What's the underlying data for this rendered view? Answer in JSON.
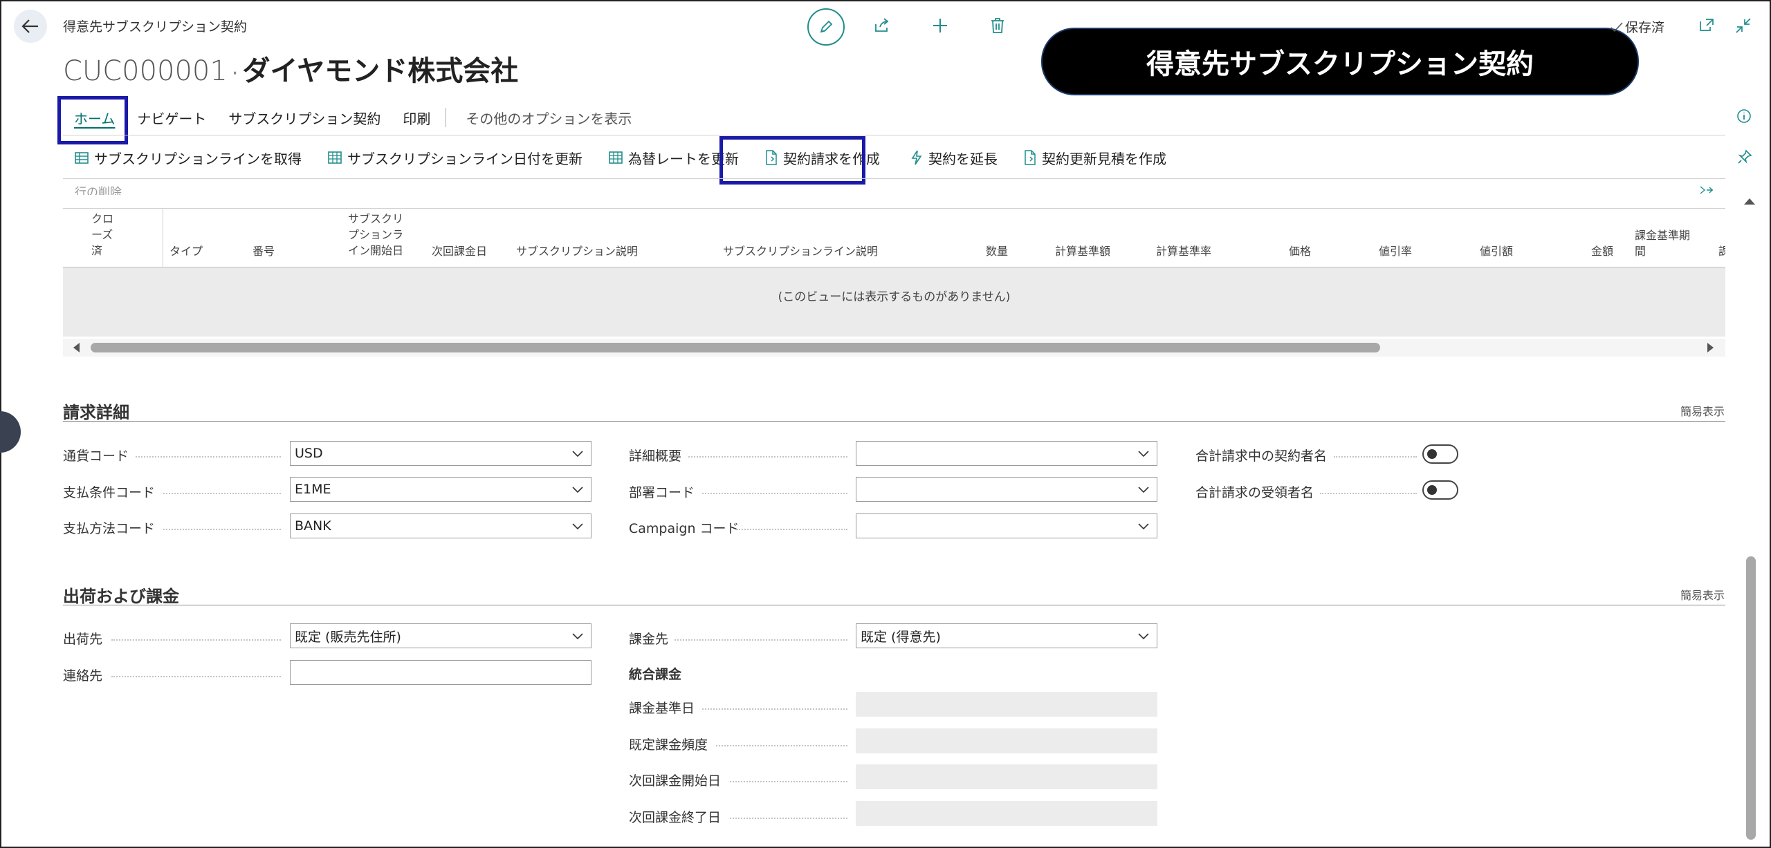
{
  "page": {
    "breadcrumb": "得意先サブスクリプション契約",
    "record_code": "CUC000001",
    "record_sep": "·",
    "record_name": "ダイヤモンド株式会社",
    "banner": "得意先サブスクリプション契約",
    "saved_status": "保存済"
  },
  "icons": [
    "back-arrow-icon",
    "edit-icon",
    "share-icon",
    "plus-icon",
    "trash-icon",
    "check-icon",
    "open-new-window-icon",
    "collapse-icon",
    "info-icon",
    "pin-icon",
    "sort-icon",
    "scroll-up-icon",
    "scroll-left-icon",
    "scroll-right-icon"
  ],
  "colors": {
    "accent": "#00706c",
    "highlight": "#1a1aa8",
    "banner_bg": "#000000"
  },
  "menu": {
    "home": "ホーム",
    "navigate": "ナビゲート",
    "subscription_contract": "サブスクリプション契約",
    "print": "印刷",
    "more_options": "その他のオプションを表示"
  },
  "actions": {
    "get_lines": "サブスクリプションラインを取得",
    "update_line_dates": "サブスクリプションライン日付を更新",
    "update_exchange_rate": "為替レートを更新",
    "create_invoice": "契約請求を作成",
    "extend_contract": "契約を延長",
    "create_renewal_quote": "契約更新見積を作成"
  },
  "lines": {
    "cut_label": "行の削除",
    "columns": {
      "closed": "クロ\nーズ\n済",
      "type": "タイプ",
      "no": "番号",
      "start_date": "サブスクリ\nプションラ\nイン開始日",
      "next_billing": "次回課金日",
      "sub_desc": "サブスクリプション説明",
      "line_desc": "サブスクリプションライン説明",
      "qty": "数量",
      "calc_base_amt": "計算基準額",
      "calc_base_pct": "計算基準率",
      "price": "価格",
      "disc_pct": "値引率",
      "disc_amt": "値引額",
      "amount": "金額",
      "billing_period": "課金基準期\n間",
      "extra": "課"
    },
    "empty_message": "(このビューには表示するものがありません)"
  },
  "billing": {
    "title": "請求詳細",
    "collapse": "簡易表示",
    "currency_label": "通貨コード",
    "currency_value": "USD",
    "payment_terms_label": "支払条件コード",
    "payment_terms_value": "E1ME",
    "payment_method_label": "支払方法コード",
    "payment_method_value": "BANK",
    "detail_overview_label": "詳細概要",
    "detail_overview_value": "",
    "dept_label": "部署コード",
    "dept_value": "",
    "campaign_label": "Campaign コード",
    "campaign_value": "",
    "contractor_on_invoice_label": "合計請求中の契約者名",
    "contractor_on_invoice_on": false,
    "recipient_on_invoice_label": "合計請求の受領者名",
    "recipient_on_invoice_on": false
  },
  "shipping": {
    "title": "出荷および課金",
    "collapse": "簡易表示",
    "ship_to_label": "出荷先",
    "ship_to_value": "既定 (販売先住所)",
    "contact_label": "連絡先",
    "contact_value": "",
    "bill_to_label": "課金先",
    "bill_to_value": "既定 (得意先)",
    "combined_billing_heading": "統合課金",
    "billing_base_date_label": "課金基準日",
    "default_billing_rhythm_label": "既定課金頻度",
    "next_billing_from_label": "次回課金開始日",
    "next_billing_to_label": "次回課金終了日"
  }
}
